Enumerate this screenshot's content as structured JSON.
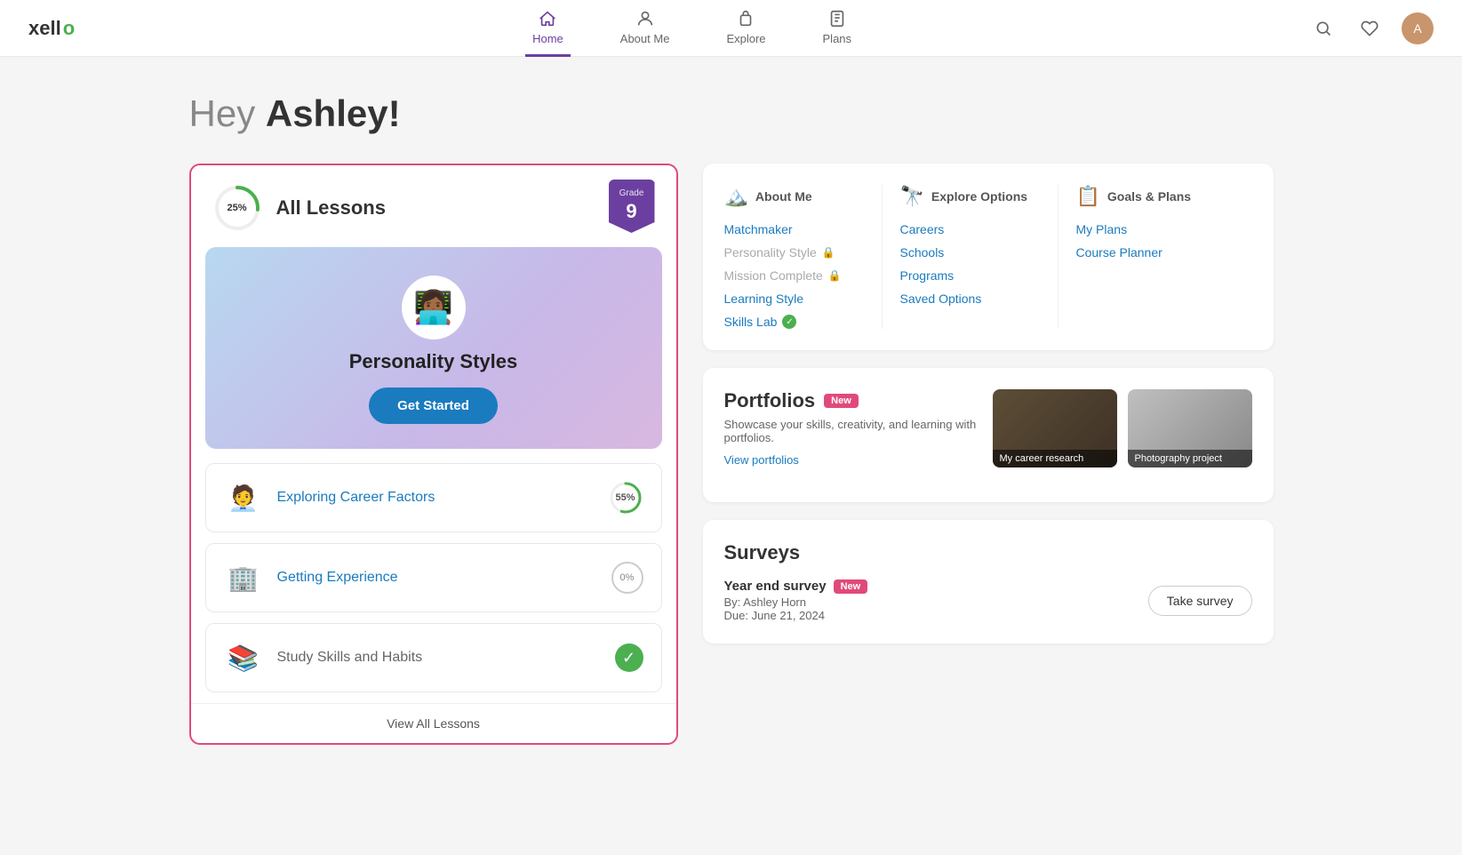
{
  "app": {
    "logo": "xello",
    "logo_accent": "o"
  },
  "nav": {
    "items": [
      {
        "id": "home",
        "label": "Home",
        "active": true
      },
      {
        "id": "about-me",
        "label": "About Me",
        "active": false
      },
      {
        "id": "explore",
        "label": "Explore",
        "active": false
      },
      {
        "id": "plans",
        "label": "Plans",
        "active": false
      }
    ]
  },
  "greeting": {
    "prefix": "Hey ",
    "name": "Ashley!"
  },
  "lessons_card": {
    "progress_pct": "25%",
    "title": "All Lessons",
    "grade_label": "Grade",
    "grade_num": "9",
    "personality_title": "Personality Styles",
    "get_started_label": "Get Started",
    "lessons": [
      {
        "name": "Exploring Career Factors",
        "progress": "55%",
        "type": "progress",
        "icon": "🧑‍💼"
      },
      {
        "name": "Getting Experience",
        "progress": "0%",
        "type": "zero",
        "icon": "🏢"
      },
      {
        "name": "Study Skills and Habits",
        "progress": "100%",
        "type": "complete",
        "icon": "📚"
      }
    ],
    "view_all_label": "View All Lessons"
  },
  "quick_links": {
    "about_me": {
      "header": "About Me",
      "links": [
        {
          "label": "Matchmaker",
          "active": true
        },
        {
          "label": "Personality Style",
          "active": false,
          "locked": true
        },
        {
          "label": "Mission Complete",
          "active": false,
          "locked": true
        },
        {
          "label": "Learning Style",
          "active": true
        },
        {
          "label": "Skills Lab",
          "active": true,
          "checked": true
        }
      ]
    },
    "explore_options": {
      "header": "Explore Options",
      "links": [
        {
          "label": "Careers",
          "active": true
        },
        {
          "label": "Schools",
          "active": true
        },
        {
          "label": "Programs",
          "active": true
        },
        {
          "label": "Saved Options",
          "active": true
        }
      ]
    },
    "goals_plans": {
      "header": "Goals & Plans",
      "links": [
        {
          "label": "My Plans",
          "active": true
        },
        {
          "label": "Course Planner",
          "active": true
        }
      ]
    }
  },
  "portfolios": {
    "title": "Portfolios",
    "new_badge": "New",
    "description": "Showcase your skills, creativity, and learning with portfolios.",
    "view_link": "View portfolios",
    "thumbs": [
      {
        "label": "My career research"
      },
      {
        "label": "Photography project"
      }
    ]
  },
  "surveys": {
    "title": "Surveys",
    "items": [
      {
        "name": "Year end survey",
        "new_badge": "New",
        "by": "By: Ashley Horn",
        "due": "Due: June 21, 2024",
        "action": "Take survey"
      }
    ]
  }
}
